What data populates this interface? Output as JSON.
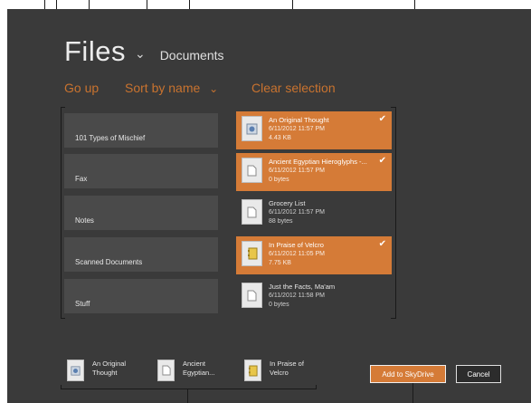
{
  "header": {
    "title": "Files",
    "title_chevron": "⌄",
    "location": "Documents"
  },
  "commands": {
    "go_up": "Go up",
    "sort": "Sort by name",
    "sort_chevron": "⌄",
    "clear": "Clear selection"
  },
  "folders": [
    {
      "name": "101 Types of Mischief"
    },
    {
      "name": "Fax"
    },
    {
      "name": "Notes"
    },
    {
      "name": "Scanned Documents"
    },
    {
      "name": "Stuff"
    }
  ],
  "files": [
    {
      "name": "An Original Thought",
      "date": "6/11/2012 11:57 PM",
      "size": "4.43 KB",
      "selected": true,
      "icon": "image-file-icon"
    },
    {
      "name": "Ancient Egyptian Hieroglyphs -...",
      "date": "6/11/2012 11:57 PM",
      "size": "0 bytes",
      "selected": true,
      "icon": "document-file-icon"
    },
    {
      "name": "Grocery List",
      "date": "6/11/2012 11:57 PM",
      "size": "88 bytes",
      "selected": false,
      "icon": "document-file-icon"
    },
    {
      "name": "In Praise of Velcro",
      "date": "6/11/2012 11:05 PM",
      "size": "7.75 KB",
      "selected": true,
      "icon": "notebook-file-icon"
    },
    {
      "name": "Just the Facts, Ma'am",
      "date": "6/11/2012 11:58 PM",
      "size": "0 bytes",
      "selected": false,
      "icon": "document-file-icon"
    }
  ],
  "check_glyph": "✔",
  "basket": [
    {
      "line1": "An Original",
      "line2": "Thought",
      "icon": "image-file-icon"
    },
    {
      "line1": "Ancient",
      "line2": "Egyptian...",
      "icon": "document-file-icon"
    },
    {
      "line1": "In Praise of",
      "line2": "Velcro",
      "icon": "notebook-file-icon"
    }
  ],
  "buttons": {
    "add": "Add to SkyDrive",
    "cancel": "Cancel"
  },
  "colors": {
    "background": "#3a3a3a",
    "accent": "#d57b37",
    "command_text": "#c9732f",
    "tile": "#4a4a4a"
  }
}
